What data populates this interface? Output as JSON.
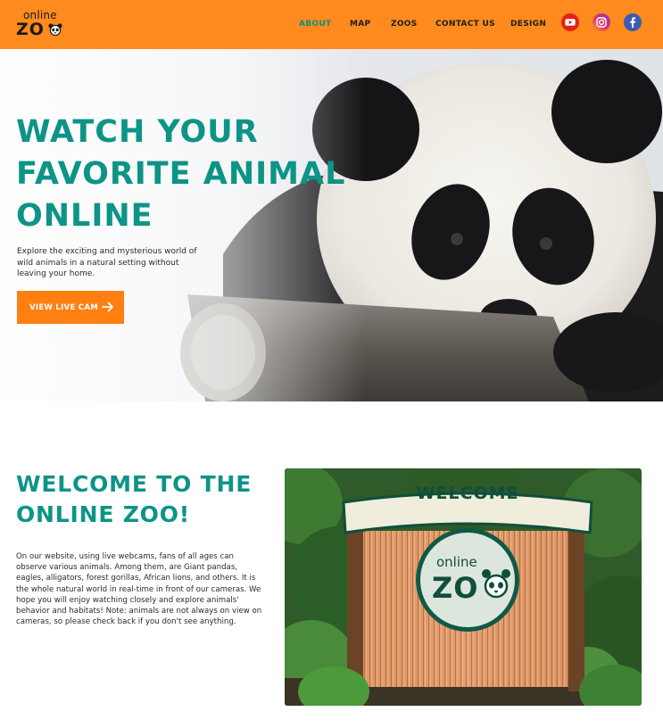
{
  "header": {
    "logo_top": "online",
    "logo_bottom": "ZO",
    "nav": [
      {
        "label": "ABOUT",
        "active": true
      },
      {
        "label": "MAP",
        "active": false
      },
      {
        "label": "ZOOS",
        "active": false
      },
      {
        "label": "CONTACT US",
        "active": false
      },
      {
        "label": "DESIGN",
        "active": false
      }
    ],
    "social": [
      "youtube-icon",
      "instagram-icon",
      "facebook-icon"
    ],
    "background_color": "#ff8a1d"
  },
  "hero": {
    "title_lines": [
      "WATCH YOUR",
      "FAVORITE ANIMAL",
      "ONLINE"
    ],
    "description": "Explore the exciting and mysterious world of wild animals in a natural setting without leaving your home.",
    "button_label": "VIEW LIVE CAM",
    "accent_color": "#0d9487",
    "button_color": "#ff7f11"
  },
  "welcome": {
    "title_lines": [
      "WELCOME TO THE",
      "ONLINE ZOO!"
    ],
    "description": "On our website, using live webcams, fans of all ages can observe various animals. Among them, are Giant pandas, eagles, alligators, forest gorillas, African lions, and others. It is the whole natural world in real-time in front of our cameras. We hope you will enjoy watching closely and explore animals' behavior and habitats! Note: animals are not always on view on cameras, so please check back if you don't see anything.",
    "sign": {
      "banner": "WELCOME",
      "logo_top": "online",
      "logo_bottom": "ZO"
    }
  }
}
